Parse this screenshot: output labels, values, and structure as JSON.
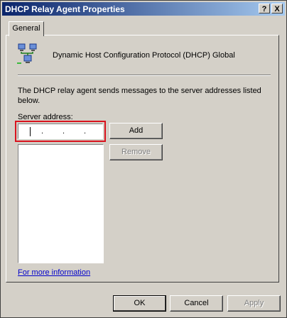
{
  "window": {
    "title": "DHCP Relay Agent Properties"
  },
  "titlebar": {
    "help": "?",
    "close": "X"
  },
  "tabs": [
    {
      "label": "General"
    }
  ],
  "header": {
    "text": "Dynamic Host Configuration Protocol (DHCP) Global"
  },
  "description": "The DHCP relay agent sends messages to the server addresses listed below.",
  "server_address": {
    "label": "Server address:",
    "ip_dots": [
      ".",
      ".",
      "."
    ]
  },
  "buttons": {
    "add": "Add",
    "remove": "Remove"
  },
  "server_list": [],
  "link": "For more information",
  "footer": {
    "ok": "OK",
    "cancel": "Cancel",
    "apply": "Apply"
  }
}
